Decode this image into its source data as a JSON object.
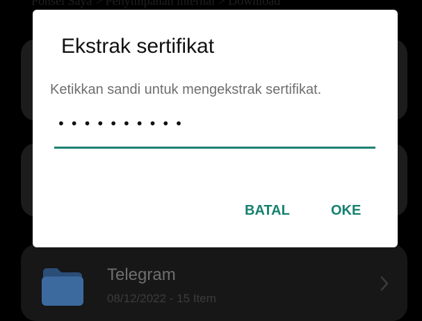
{
  "background": {
    "breadcrumb": "Ponsel Saya  >  Penyimpanan internal  >  Download",
    "folders": [
      {
        "name": "Telegram",
        "meta": "08/12/2022 - 15 Item",
        "icon": "folder-icon"
      }
    ]
  },
  "dialog": {
    "title": "Ekstrak sertifikat",
    "message": "Ketikkan sandi untuk mengekstrak sertifikat.",
    "password_value": "••••••••••",
    "cancel_label": "BATAL",
    "ok_label": "OKE"
  },
  "colors": {
    "accent": "#16806f",
    "dialog_bg": "#ffffff",
    "screen_bg": "#000000"
  }
}
